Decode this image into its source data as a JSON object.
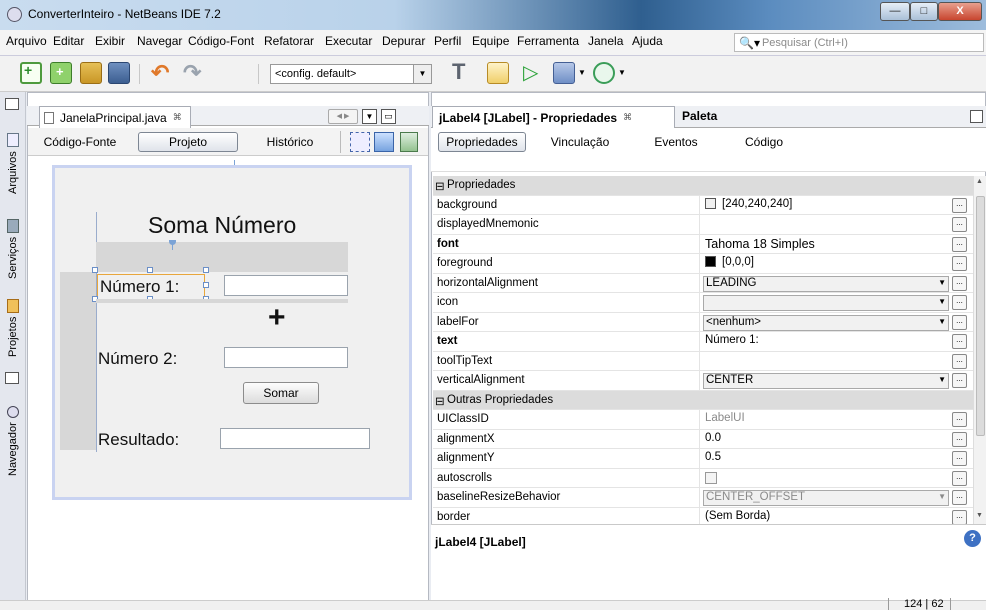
{
  "window": {
    "title": "ConverterInteiro - NetBeans IDE 7.2",
    "min_label": "—",
    "max_label": "□",
    "close_label": "X"
  },
  "menu": {
    "items": [
      "Arquivo",
      "Editar",
      "Exibir",
      "Navegar",
      "Código-Font",
      "Refatorar",
      "Executar",
      "Depurar",
      "Perfil",
      "Equipe",
      "Ferramenta",
      "Janela",
      "Ajuda"
    ],
    "search_placeholder": "Pesquisar (Ctrl+I)"
  },
  "toolbar": {
    "config_value": "<config. default>"
  },
  "left_strip": {
    "tabs": [
      "Arquivos",
      "Serviços",
      "Projetos",
      "Navegador"
    ]
  },
  "editor": {
    "file_tab": "JanelaPrincipal.java",
    "close_glyph": "⌘",
    "sub_tabs": [
      "Código-Fonte",
      "Projeto",
      "Histórico"
    ]
  },
  "form": {
    "title": "Soma Número",
    "label1": "Número 1:",
    "plus": "+",
    "label2": "Número 2:",
    "button": "Somar",
    "label3": "Resultado:"
  },
  "properties_panel": {
    "tab_title": "jLabel4 [JLabel] - Propriedades",
    "tab_close": "⌘",
    "palette_tab": "Paleta",
    "sub_tabs": [
      "Propriedades",
      "Vinculação",
      "Eventos",
      "Código"
    ],
    "rows": [
      {
        "name": "Propriedades",
        "category": true
      },
      {
        "name": "background",
        "value": "[240,240,240]",
        "swatch": "#f0f0f0"
      },
      {
        "name": "displayedMnemonic",
        "value": ""
      },
      {
        "name": "font",
        "value": "Tahoma 18 Simples",
        "bold": true
      },
      {
        "name": "foreground",
        "value": "[0,0,0]",
        "swatch": "#000000"
      },
      {
        "name": "horizontalAlignment",
        "value": "LEADING",
        "combo": true
      },
      {
        "name": "icon",
        "value": "",
        "combo": true
      },
      {
        "name": "labelFor",
        "value": "<nenhum>",
        "combo": true
      },
      {
        "name": "text",
        "value": "Número 1:",
        "bold": true
      },
      {
        "name": "toolTipText",
        "value": ""
      },
      {
        "name": "verticalAlignment",
        "value": "CENTER",
        "combo": true
      },
      {
        "name": "Outras Propriedades",
        "category": true
      },
      {
        "name": "UIClassID",
        "value": "LabelUI",
        "gray": true
      },
      {
        "name": "alignmentX",
        "value": "0.0"
      },
      {
        "name": "alignmentY",
        "value": "0.5"
      },
      {
        "name": "autoscrolls",
        "value": "",
        "checkbox": true
      },
      {
        "name": "baselineResizeBehavior",
        "value": "CENTER_OFFSET",
        "combo": true,
        "gray": true
      },
      {
        "name": "border",
        "value": "(Sem Borda)"
      }
    ],
    "description_title": "jLabel4 [JLabel]"
  },
  "status": {
    "position": "124 | 62"
  }
}
